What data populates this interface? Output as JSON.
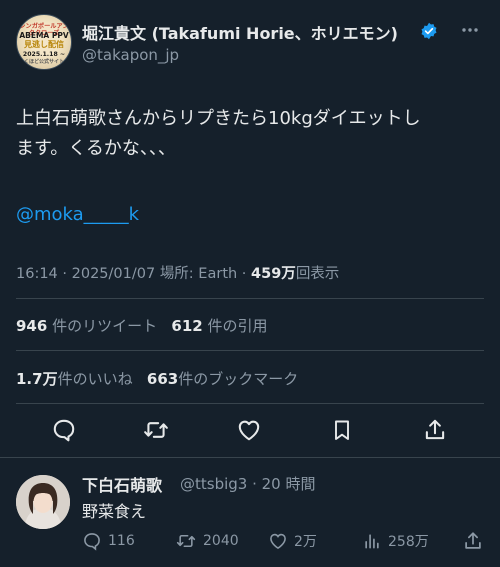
{
  "tweet": {
    "author_name": "堀江貴文 (Takafumi Horie、ホリエモン)",
    "handle": "@takapon_jp",
    "avatar_lines": [
      "シンガポールアンタクローズ",
      "ABEMA PPV",
      "見逃し配信",
      "2025.1.18 ~",
      "くほど公式サイト"
    ],
    "text": "上白石萌歌さんからリプきたら10kgダイエットし\nます。くるかな、、、",
    "mention": "@moka_____k",
    "time": "16:14",
    "date": "2025/01/07",
    "place_label": "場所: Earth",
    "views_count": "459万",
    "views_label": "回表示"
  },
  "stats": {
    "retweets_count": "946",
    "retweets_label": "件のリツイート",
    "quotes_count": "612",
    "quotes_label": "件の引用",
    "likes_count": "1.7万",
    "likes_label": "件のいいね",
    "bookmarks_count": "663",
    "bookmarks_label": "件のブックマーク"
  },
  "actions": [
    "reply-icon",
    "retweet-icon",
    "like-icon",
    "bookmark-icon",
    "share-icon"
  ],
  "reply": {
    "author_name": "下白石萌歌",
    "handle_time": "@ttsbig3 · 20 時間",
    "text": "野菜食え",
    "replies": "116",
    "retweets": "2040",
    "likes": "2万",
    "views": "258万"
  },
  "colors": {
    "background": "#15202b",
    "accent": "#1d9bf0",
    "muted": "#8b98a5",
    "text": "#e7e9ea"
  }
}
